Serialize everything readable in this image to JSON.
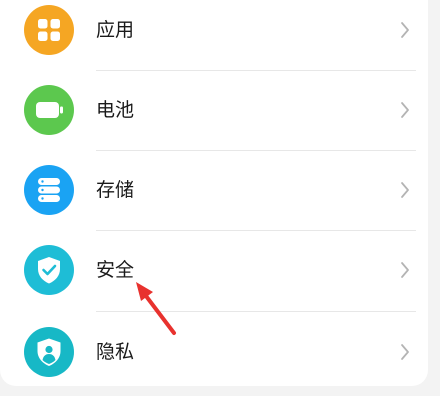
{
  "settings": {
    "items": [
      {
        "label": "应用",
        "icon": "apps-grid-icon",
        "color": "#f5a623"
      },
      {
        "label": "电池",
        "icon": "battery-icon",
        "color": "#5cc84e"
      },
      {
        "label": "存储",
        "icon": "storage-icon",
        "color": "#1aa3f3"
      },
      {
        "label": "安全",
        "icon": "shield-check-icon",
        "color": "#1ebdd6"
      },
      {
        "label": "隐私",
        "icon": "privacy-shield-icon",
        "color": "#17b8c6"
      }
    ]
  },
  "annotation": {
    "icon": "red-arrow-icon",
    "color": "#e8322e"
  }
}
